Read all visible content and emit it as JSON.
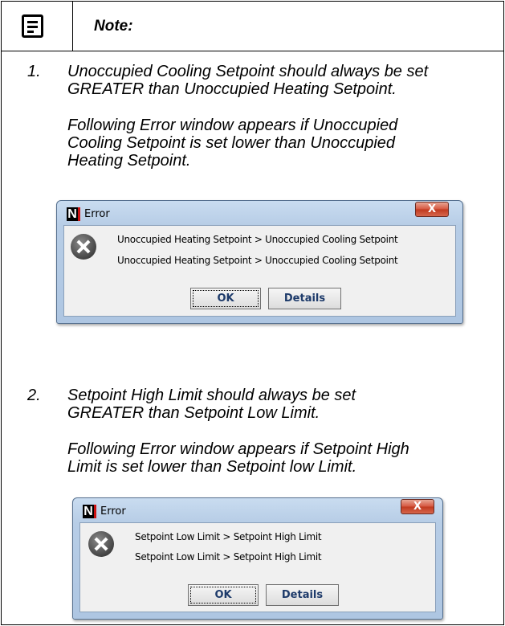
{
  "note": {
    "title": "Note:",
    "icon": "note-icon"
  },
  "items": [
    {
      "number": "1.",
      "line1": "Unoccupied Cooling Setpoint should always be set",
      "line2": "GREATER than Unoccupied Heating Setpoint.",
      "desc1": "Following Error window appears if Unoccupied",
      "desc2": "Cooling Setpoint is set lower than Unoccupied",
      "desc3": "Heating Setpoint.",
      "dialog": {
        "title": "Error",
        "close_label": "X",
        "message1": "Unoccupied Heating Setpoint > Unoccupied Cooling Setpoint",
        "message2": "Unoccupied Heating Setpoint > Unoccupied Cooling Setpoint",
        "ok_label": "OK",
        "details_label": "Details"
      }
    },
    {
      "number": "2.",
      "line1": "Setpoint High Limit should always be set",
      "line2": "GREATER than Setpoint Low Limit.",
      "desc1": "Following Error window appears if Setpoint High",
      "desc2": "Limit is set lower than Setpoint low Limit.",
      "dialog": {
        "title": "Error",
        "close_label": "X",
        "message1": "Setpoint Low Limit > Setpoint High Limit",
        "message2": "Setpoint Low Limit > Setpoint High Limit",
        "ok_label": "OK",
        "details_label": "Details"
      }
    }
  ]
}
